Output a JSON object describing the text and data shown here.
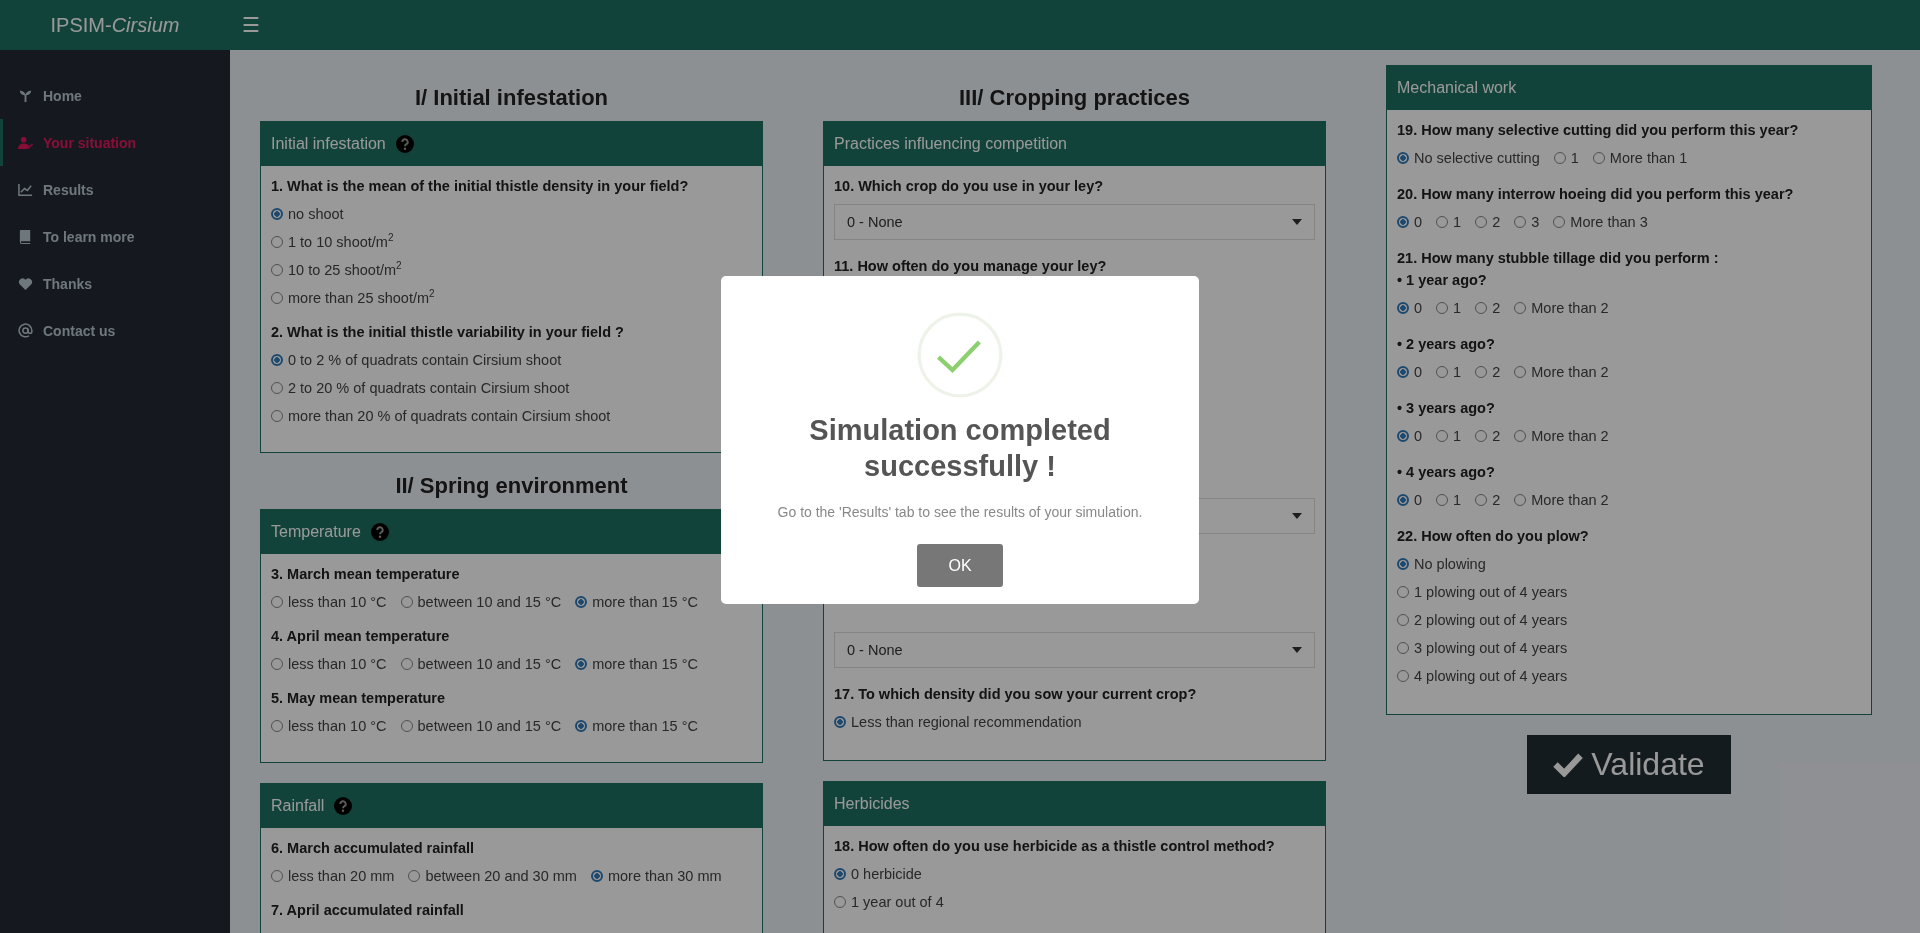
{
  "header": {
    "brand": "IPSIM-",
    "brand_italic": "Cirsium",
    "menu_toggle": "☰"
  },
  "sidebar": {
    "items": [
      {
        "label": "Home",
        "selected": false
      },
      {
        "label": "Your situation",
        "selected": true
      },
      {
        "label": "Results",
        "selected": false
      },
      {
        "label": "To learn more",
        "selected": false
      },
      {
        "label": "Thanks",
        "selected": false
      },
      {
        "label": "Contact us",
        "selected": false
      }
    ]
  },
  "columns": [
    {
      "cards": [
        {
          "section_title": "I/ Initial infestation",
          "title": "Initial infestation",
          "help": true,
          "questions": [
            {
              "kind": "radio_list",
              "label": "1. What is the mean of the initial thistle density in your field?",
              "options": [
                {
                  "label": "no shoot",
                  "selected": true
                },
                {
                  "label": "1 to 10 shoot/m$^{2}$",
                  "selected": false
                },
                {
                  "label": "10 to 25 shoot/m$^{2}$",
                  "selected": false
                },
                {
                  "label": "more than 25 shoot/m$^{2}$",
                  "selected": false
                }
              ]
            },
            {
              "kind": "radio_list",
              "label": "2. What is the initial thistle variability in your field ?",
              "options": [
                {
                  "label": "0 to 2 % of quadrats contain Cirsium shoot",
                  "selected": true
                },
                {
                  "label": "2 to 20 % of quadrats contain Cirsium shoot",
                  "selected": false
                },
                {
                  "label": "more than 20 % of quadrats contain Cirsium shoot",
                  "selected": false
                }
              ]
            }
          ]
        },
        {
          "section_title": "II/ Spring environment",
          "title": "Temperature",
          "help": true,
          "questions": [
            {
              "kind": "radio_row",
              "label": "3. March mean temperature",
              "options": [
                {
                  "label": "less than 10 °C",
                  "selected": false
                },
                {
                  "label": "between 10 and 15 °C",
                  "selected": false
                },
                {
                  "label": "more than 15 °C",
                  "selected": true
                }
              ]
            },
            {
              "kind": "radio_row",
              "label": "4. April mean temperature",
              "options": [
                {
                  "label": "less than 10 °C",
                  "selected": false
                },
                {
                  "label": "between 10 and 15 °C",
                  "selected": false
                },
                {
                  "label": "more than 15 °C",
                  "selected": true
                }
              ]
            },
            {
              "kind": "radio_row",
              "label": "5. May mean temperature",
              "options": [
                {
                  "label": "less than 10 °C",
                  "selected": false
                },
                {
                  "label": "between 10 and 15 °C",
                  "selected": false
                },
                {
                  "label": "more than 15 °C",
                  "selected": true
                }
              ]
            }
          ]
        },
        {
          "title": "Rainfall",
          "help": true,
          "questions": [
            {
              "kind": "radio_row",
              "label": "6. March accumulated rainfall",
              "options": [
                {
                  "label": "less than 20 mm",
                  "selected": false
                },
                {
                  "label": "between 20 and 30 mm",
                  "selected": false
                },
                {
                  "label": "more than 30 mm",
                  "selected": true
                }
              ]
            },
            {
              "kind": "heading",
              "label": "7. April accumulated rainfall"
            }
          ]
        }
      ]
    },
    {
      "cards": [
        {
          "section_title": "III/ Cropping practices",
          "title": "Practices influencing competition",
          "help": false,
          "questions": [
            {
              "kind": "select",
              "label": "10. Which crop do you use in your ley?",
              "value": "0 - None"
            },
            {
              "kind": "heading",
              "label": "11. How often do you manage your ley?"
            },
            {
              "kind": "select"
            },
            {
              "kind": "select",
              "value": "0 - None"
            },
            {
              "kind": "radio_list",
              "label": "17. To which density did you sow your current crop?",
              "options": [
                {
                  "label": "Less than regional recommendation",
                  "selected": true
                }
              ]
            }
          ]
        },
        {
          "title": "Herbicides",
          "help": false,
          "questions": [
            {
              "kind": "radio_list",
              "label": "18. How often do you use herbicide as a thistle control method?",
              "options": [
                {
                  "label": "0 herbicide",
                  "selected": true
                },
                {
                  "label": "1 year out of 4",
                  "selected": false
                }
              ]
            }
          ]
        }
      ]
    },
    {
      "cards": [
        {
          "title": "Mechanical work",
          "help": false,
          "questions": [
            {
              "kind": "radio_row",
              "label": "19. How many selective cutting did you perform this year?",
              "options": [
                {
                  "label": "No selective cutting",
                  "selected": true
                },
                {
                  "label": "1",
                  "selected": false
                },
                {
                  "label": "More than 1",
                  "selected": false
                }
              ]
            },
            {
              "kind": "radio_row",
              "label": "20. How many interrow hoeing did you perform this year?",
              "options": [
                {
                  "label": "0",
                  "selected": true
                },
                {
                  "label": "1",
                  "selected": false
                },
                {
                  "label": "2",
                  "selected": false
                },
                {
                  "label": "3",
                  "selected": false
                },
                {
                  "label": "More than 3",
                  "selected": false
                }
              ]
            },
            {
              "kind": "heading",
              "label": "21. How many stubble tillage did you perform :"
            },
            {
              "kind": "radio_row",
              "label": "• 1 year ago?",
              "options": [
                {
                  "label": "0",
                  "selected": true
                },
                {
                  "label": "1",
                  "selected": false
                },
                {
                  "label": "2",
                  "selected": false
                },
                {
                  "label": "More than 2",
                  "selected": false
                }
              ]
            },
            {
              "kind": "radio_row",
              "label": "• 2 years ago?",
              "options": [
                {
                  "label": "0",
                  "selected": true
                },
                {
                  "label": "1",
                  "selected": false
                },
                {
                  "label": "2",
                  "selected": false
                },
                {
                  "label": "More than 2",
                  "selected": false
                }
              ]
            },
            {
              "kind": "radio_row",
              "label": "• 3 years ago?",
              "options": [
                {
                  "label": "0",
                  "selected": true
                },
                {
                  "label": "1",
                  "selected": false
                },
                {
                  "label": "2",
                  "selected": false
                },
                {
                  "label": "More than 2",
                  "selected": false
                }
              ]
            },
            {
              "kind": "radio_row",
              "label": "• 4 years ago?",
              "options": [
                {
                  "label": "0",
                  "selected": true
                },
                {
                  "label": "1",
                  "selected": false
                },
                {
                  "label": "2",
                  "selected": false
                },
                {
                  "label": "More than 2",
                  "selected": false
                }
              ]
            },
            {
              "kind": "radio_list",
              "label": "22. How often do you plow?",
              "options": [
                {
                  "label": "No plowing",
                  "selected": true
                },
                {
                  "label": "1 plowing out of 4 years",
                  "selected": false
                },
                {
                  "label": "2 plowing out of 4 years",
                  "selected": false
                },
                {
                  "label": "3 plowing out of 4 years",
                  "selected": false
                },
                {
                  "label": "4 plowing out of 4 years",
                  "selected": false
                }
              ]
            }
          ]
        }
      ],
      "validate_button": "Validate"
    }
  ],
  "modal": {
    "title": "Simulation completed successfully !",
    "message": "Go to the 'Results' tab to see the results of your simulation.",
    "button": "OK"
  }
}
